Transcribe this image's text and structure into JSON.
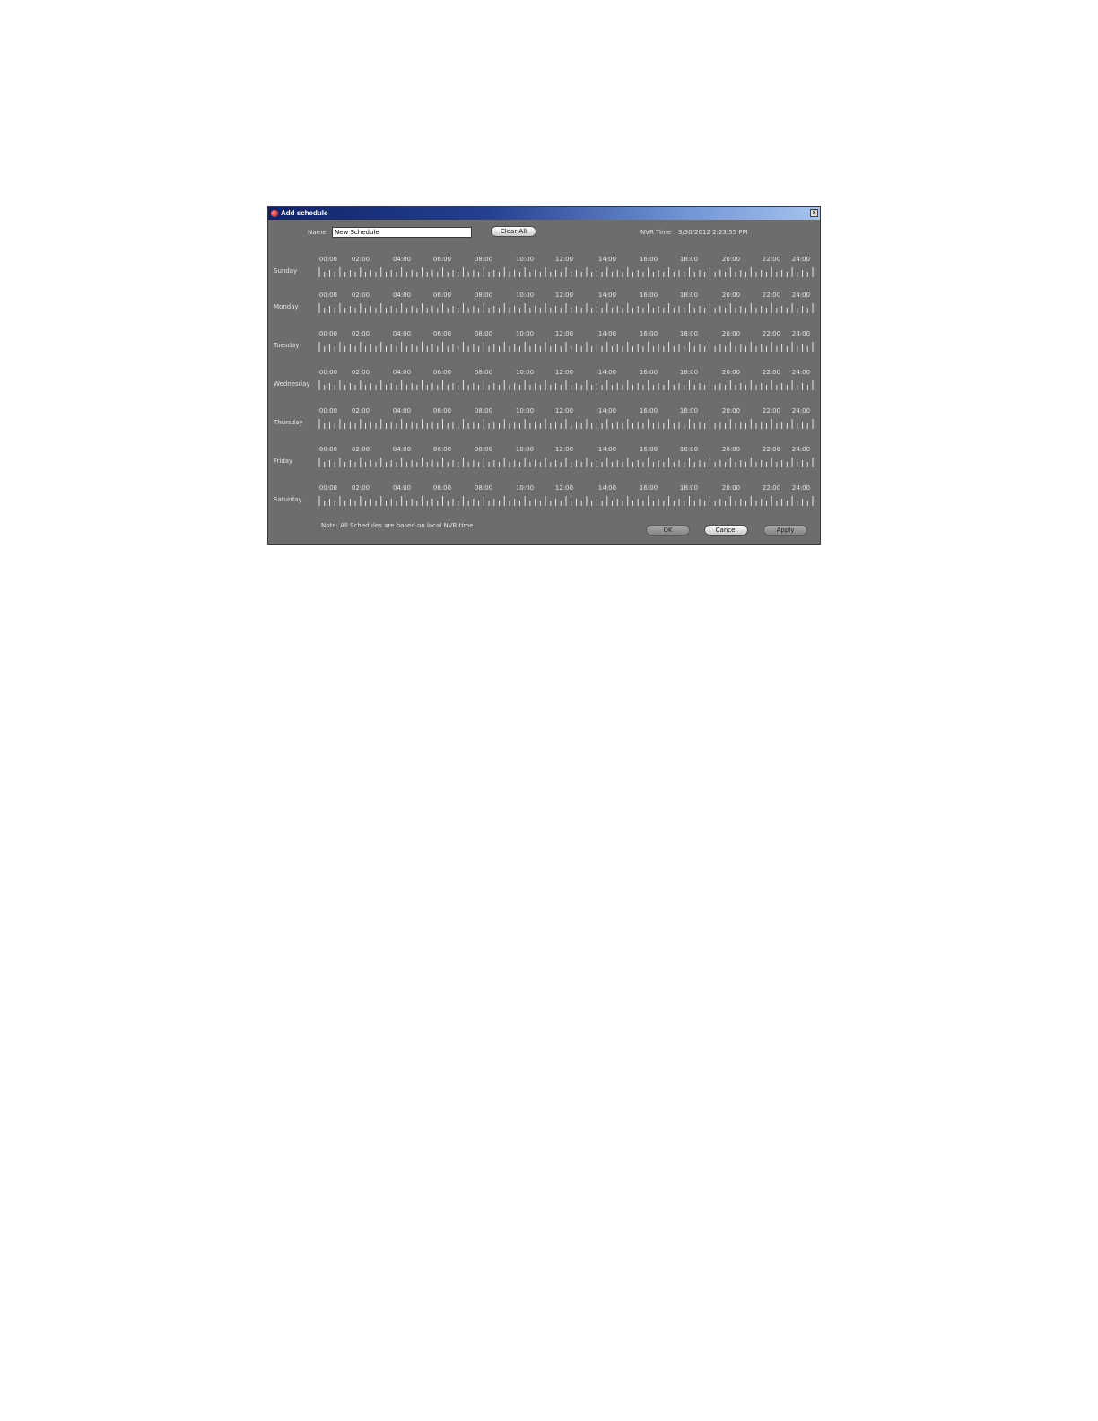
{
  "window": {
    "title": "Add schedule",
    "close_glyph": "✕",
    "app_icon": "app-logo-icon"
  },
  "form": {
    "name_label": "Name",
    "name_value": "New Schedule",
    "clear_all_label": "Clear All",
    "nvr_time_label": "NVR Time",
    "nvr_time_value": "3/30/2012 2:23:55 PM"
  },
  "hours": [
    "00:00",
    "02:00",
    "04:00",
    "06:00",
    "08:00",
    "10:00",
    "12:00",
    "14:00",
    "16:00",
    "18:00",
    "20:00",
    "22:00",
    "24:00"
  ],
  "days": [
    "Sunday",
    "Monday",
    "Tuesday",
    "Wednesday",
    "Thursday",
    "Friday",
    "Saturday"
  ],
  "note": "Note: All Schedules are based on local NVR time",
  "buttons": {
    "ok": "OK",
    "cancel": "Cancel",
    "apply": "Apply"
  },
  "colors": {
    "dialog_bg": "#6d6d6d",
    "tick_color": "#e6e6e6",
    "title_bar_start": "#10246a",
    "title_bar_end": "#a6c4ee"
  }
}
